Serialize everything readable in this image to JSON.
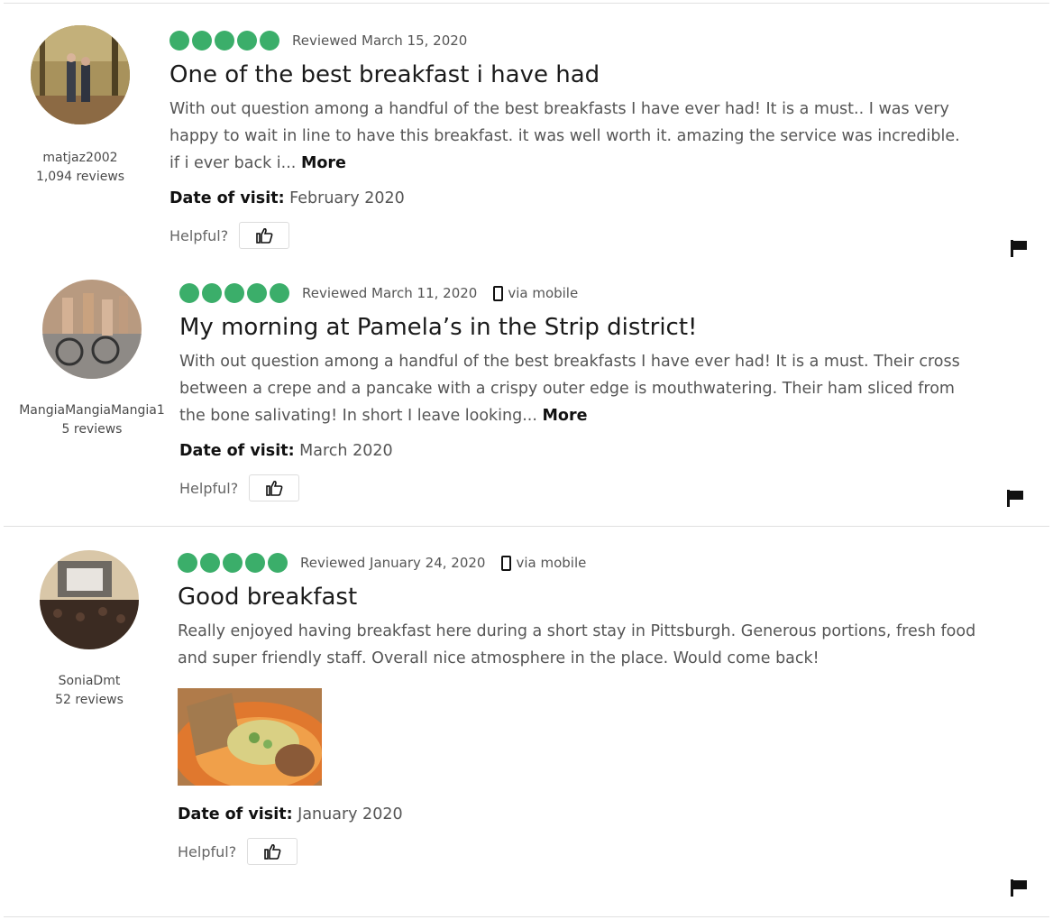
{
  "colors": {
    "bubble": "#3bae6a",
    "text": "#555555",
    "title": "#1a1a1a"
  },
  "reviews": [
    {
      "user": {
        "name": "matjaz2002",
        "count": "1,094 reviews",
        "avatar": "avatar-photo-park"
      },
      "rating": 5,
      "reviewed": "Reviewed March 15, 2020",
      "mobile": "",
      "title": "One of the best breakfast i have had",
      "body": "With out question among a handful of the best breakfasts I have ever had! It is a must.. I was very happy to wait in line to have this breakfast. it was well worth it. amazing the service was incredible. if i ever back i...",
      "more": "More",
      "visit_label": "Date of visit:",
      "visit_value": "February 2020",
      "helpful": "Helpful?"
    },
    {
      "user": {
        "name": "MangiaMangiaMangia1",
        "count": "5 reviews",
        "avatar": "avatar-photo-cyclists"
      },
      "rating": 5,
      "reviewed": "Reviewed March 11, 2020",
      "mobile": "via mobile",
      "title": "My morning at Pamela’s in the Strip district!",
      "body": "With out question among a handful of the best breakfasts I have ever had! It is a must. Their cross between a crepe and a pancake with a crispy outer edge is mouthwatering. Their ham sliced from the bone salivating! In short I leave looking...",
      "more": "More",
      "visit_label": "Date of visit:",
      "visit_value": "March 2020",
      "helpful": "Helpful?"
    },
    {
      "user": {
        "name": "SoniaDmt",
        "count": "52 reviews",
        "avatar": "avatar-photo-concert"
      },
      "rating": 5,
      "reviewed": "Reviewed January 24, 2020",
      "mobile": "via mobile",
      "title": "Good breakfast",
      "body": "Really enjoyed having breakfast here during a short stay in Pittsburgh. Generous portions, fresh food and super friendly staff. Overall nice atmosphere in the place. Would come back!",
      "more": "",
      "visit_label": "Date of visit:",
      "visit_value": "January 2020",
      "helpful": "Helpful?"
    }
  ]
}
